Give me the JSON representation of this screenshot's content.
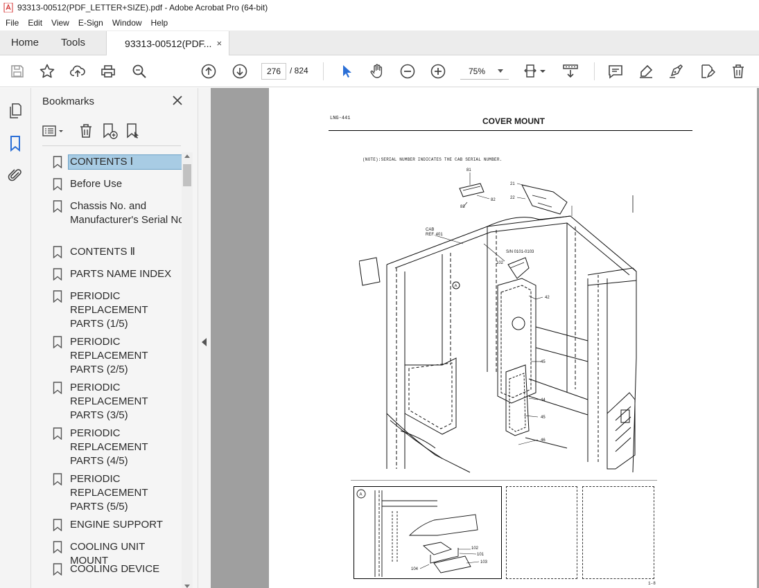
{
  "window": {
    "title": "93313-00512(PDF_LETTER+SIZE).pdf - Adobe Acrobat Pro (64-bit)"
  },
  "menu": [
    "File",
    "Edit",
    "View",
    "E-Sign",
    "Window",
    "Help"
  ],
  "tabs": {
    "home": "Home",
    "tools": "Tools",
    "document": "93313-00512(PDF...",
    "close_symbol": "×"
  },
  "toolbar": {
    "page_current": "276",
    "page_total": "/ 824",
    "zoom": "75%"
  },
  "bookmarks": {
    "title": "Bookmarks",
    "items": [
      {
        "label": "CONTENTS Ⅰ",
        "selected": true
      },
      {
        "label": "Before Use"
      },
      {
        "label": "Chassis No. and Manufacturer's Serial No"
      },
      {
        "label": "CONTENTS Ⅱ"
      },
      {
        "label": "PARTS NAME INDEX"
      },
      {
        "label": "PERIODIC REPLACEMENT PARTS (1/5)"
      },
      {
        "label": "PERIODIC REPLACEMENT PARTS (2/5)"
      },
      {
        "label": "PERIODIC REPLACEMENT PARTS (3/5)"
      },
      {
        "label": "PERIODIC REPLACEMENT PARTS (4/5)"
      },
      {
        "label": "PERIODIC REPLACEMENT PARTS (5/5)"
      },
      {
        "label": "ENGINE SUPPORT"
      },
      {
        "label": "COOLING UNIT MOUNT"
      },
      {
        "label": "COOLING DEVICE"
      }
    ]
  },
  "document": {
    "code": "LNG-441",
    "title": "COVER MOUNT",
    "note": "(NOTE):SERIAL NUMBER INDICATES THE CAB SERIAL NUMBER.",
    "footer": "1-8",
    "callouts": {
      "c81": "81",
      "c82": "82",
      "c83": "83",
      "c21": "21",
      "c22": "22",
      "cab": "CAB",
      "ref": "REF. 401",
      "sn": "S/N 0101-0103",
      "c102a": "102",
      "c42": "42",
      "c45a": "45",
      "c44": "44",
      "c45b": "45",
      "c46": "46",
      "markA": "A",
      "markA2": "A",
      "d102": "102",
      "d101": "101",
      "d103": "103",
      "d104": "104"
    }
  },
  "colors": {
    "accent": "#2b6fd6",
    "selection": "#a8cce4",
    "doc_bg": "#9f9f9f"
  }
}
